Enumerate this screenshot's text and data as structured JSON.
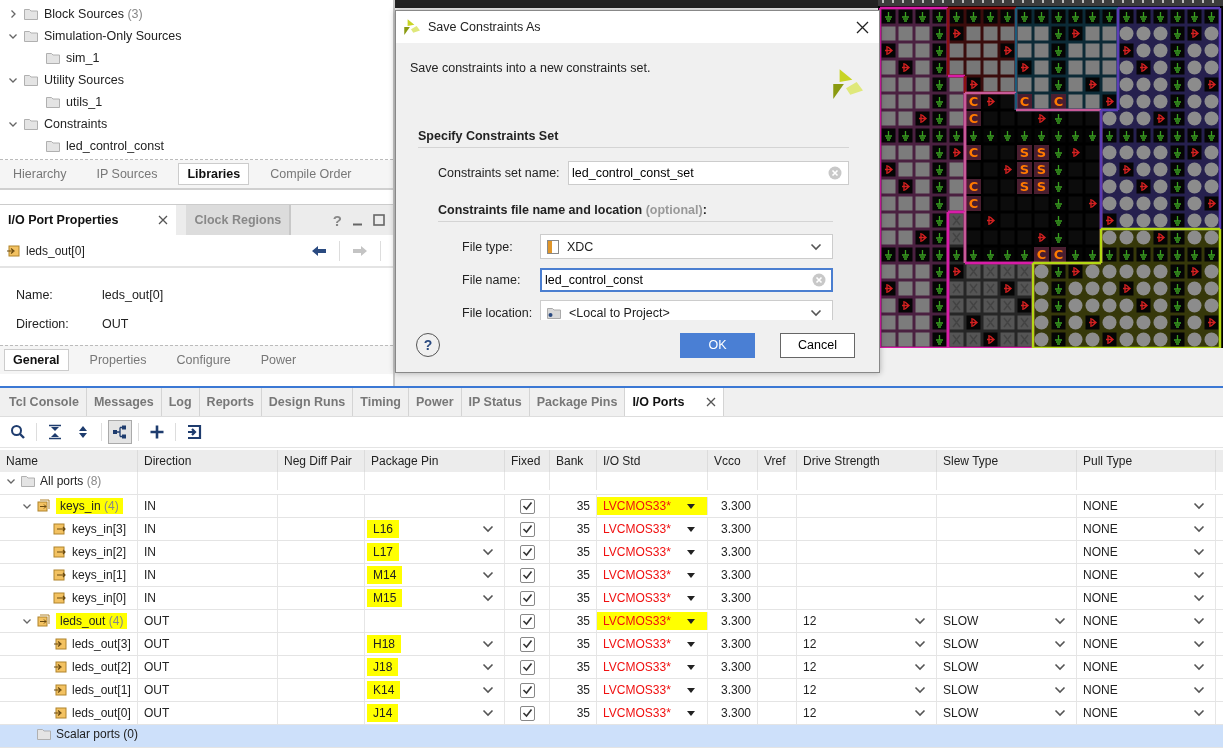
{
  "sources_tree": {
    "items": [
      {
        "label": "Block Sources",
        "count": "(3)",
        "expanded": false
      },
      {
        "label": "Simulation-Only Sources",
        "expanded": true,
        "children": [
          {
            "label": "sim_1"
          }
        ]
      },
      {
        "label": "Utility Sources",
        "expanded": true,
        "children": [
          {
            "label": "utils_1"
          }
        ]
      },
      {
        "label": "Constraints",
        "expanded": true,
        "children": [
          {
            "label": "led_control_const"
          }
        ]
      }
    ]
  },
  "sources_tabs": [
    {
      "label": "Hierarchy",
      "selected": false
    },
    {
      "label": "IP Sources",
      "selected": false
    },
    {
      "label": "Libraries",
      "selected": true
    },
    {
      "label": "Compile Order",
      "selected": false
    }
  ],
  "properties_panel": {
    "tabs": [
      {
        "label": "I/O Port Properties",
        "selected": true
      },
      {
        "label": "Clock Regions",
        "selected": false
      }
    ],
    "help": "?",
    "object": "leds_out[0]",
    "fields": [
      {
        "label": "Name:",
        "value": "leds_out[0]"
      },
      {
        "label": "Direction:",
        "value": "OUT"
      }
    ],
    "bottom_tabs": [
      {
        "label": "General",
        "selected": true
      },
      {
        "label": "Properties",
        "selected": false
      },
      {
        "label": "Configure",
        "selected": false
      },
      {
        "label": "Power",
        "selected": false
      }
    ]
  },
  "package_view": {
    "pin_labels": [
      "C",
      "C",
      "C",
      "C",
      "C",
      "C",
      "C",
      "C",
      "C",
      "S",
      "S",
      "S",
      "S",
      "S",
      "S"
    ]
  },
  "dialog": {
    "title": "Save Constraints As",
    "description": "Save constraints into a new constraints set.",
    "set_section": {
      "title": "Specify Constraints Set",
      "fields": [
        {
          "kind": "text",
          "label": "Constraints set name:",
          "value": "led_control_const_set",
          "focused": false
        }
      ]
    },
    "file_section": {
      "title": "Constraints file name and location",
      "note": "(optional)",
      "end": ":",
      "fields": [
        {
          "kind": "filetype",
          "label": "File type:",
          "value": "XDC"
        },
        {
          "kind": "text",
          "label": "File name:",
          "value": "led_control_const",
          "focused": true
        },
        {
          "kind": "location",
          "label": "File location:",
          "value": "<Local to Project>"
        }
      ]
    },
    "help": "?",
    "buttons": [
      {
        "label": "OK",
        "primary": true
      },
      {
        "label": "Cancel",
        "primary": false
      }
    ]
  },
  "bottom_tabs": [
    {
      "label": "Tcl Console",
      "selected": false
    },
    {
      "label": "Messages",
      "selected": false
    },
    {
      "label": "Log",
      "selected": false
    },
    {
      "label": "Reports",
      "selected": false
    },
    {
      "label": "Design Runs",
      "selected": false
    },
    {
      "label": "Timing",
      "selected": false
    },
    {
      "label": "Power",
      "selected": false
    },
    {
      "label": "IP Status",
      "selected": false
    },
    {
      "label": "Package Pins",
      "selected": false
    },
    {
      "label": "I/O Ports",
      "selected": true
    }
  ],
  "toolbar": [
    {
      "kind": "search",
      "pressed": false
    },
    {
      "kind": "collapse",
      "pressed": false
    },
    {
      "kind": "expand",
      "pressed": false
    },
    {
      "kind": "group",
      "pressed": true
    },
    {
      "kind": "add",
      "pressed": false
    },
    {
      "kind": "import",
      "pressed": false
    }
  ],
  "io_ports": {
    "columns": [
      "Name",
      "Direction",
      "Neg Diff Pair",
      "Package Pin",
      "Fixed",
      "Bank",
      "I/O Std",
      "Vcco",
      "Vref",
      "Drive Strength",
      "Slew Type",
      "Pull Type"
    ],
    "rows": [
      {
        "kind": "folder",
        "name": "All ports",
        "count": "(8)",
        "expanded": true,
        "selected": false,
        "children": [
          {
            "kind": "bus",
            "name": "keys_in",
            "count": "(4)",
            "highlighted": true,
            "expanded": true,
            "selected": false,
            "direction": "IN",
            "fixed": true,
            "bank": "35",
            "io_std": "LVCMOS33*",
            "io_std_highlighted": true,
            "vcco": "3.300",
            "pull_type": "NONE",
            "children": [
              {
                "kind": "input",
                "name": "keys_in[3]",
                "highlighted": false,
                "selected": false,
                "direction": "IN",
                "package_pin": "L16",
                "pin_highlighted": true,
                "fixed": true,
                "bank": "35",
                "io_std": "LVCMOS33*",
                "io_std_highlighted": false,
                "vcco": "3.300",
                "pull_type": "NONE"
              },
              {
                "kind": "input",
                "name": "keys_in[2]",
                "highlighted": false,
                "selected": false,
                "direction": "IN",
                "package_pin": "L17",
                "pin_highlighted": true,
                "fixed": true,
                "bank": "35",
                "io_std": "LVCMOS33*",
                "io_std_highlighted": false,
                "vcco": "3.300",
                "pull_type": "NONE"
              },
              {
                "kind": "input",
                "name": "keys_in[1]",
                "highlighted": false,
                "selected": false,
                "direction": "IN",
                "package_pin": "M14",
                "pin_highlighted": true,
                "fixed": true,
                "bank": "35",
                "io_std": "LVCMOS33*",
                "io_std_highlighted": false,
                "vcco": "3.300",
                "pull_type": "NONE"
              },
              {
                "kind": "input",
                "name": "keys_in[0]",
                "highlighted": false,
                "selected": false,
                "direction": "IN",
                "package_pin": "M15",
                "pin_highlighted": true,
                "fixed": true,
                "bank": "35",
                "io_std": "LVCMOS33*",
                "io_std_highlighted": false,
                "vcco": "3.300",
                "pull_type": "NONE"
              }
            ]
          },
          {
            "kind": "bus",
            "name": "leds_out",
            "count": "(4)",
            "highlighted": true,
            "expanded": true,
            "selected": false,
            "direction": "OUT",
            "fixed": true,
            "bank": "35",
            "io_std": "LVCMOS33*",
            "io_std_highlighted": true,
            "vcco": "3.300",
            "drive_strength": "12",
            "slew_type": "SLOW",
            "pull_type": "NONE",
            "children": [
              {
                "kind": "output",
                "name": "leds_out[3]",
                "highlighted": false,
                "selected": false,
                "direction": "OUT",
                "package_pin": "H18",
                "pin_highlighted": true,
                "fixed": true,
                "bank": "35",
                "io_std": "LVCMOS33*",
                "io_std_highlighted": false,
                "vcco": "3.300",
                "drive_strength": "12",
                "slew_type": "SLOW",
                "pull_type": "NONE"
              },
              {
                "kind": "output",
                "name": "leds_out[2]",
                "highlighted": false,
                "selected": false,
                "direction": "OUT",
                "package_pin": "J18",
                "pin_highlighted": true,
                "fixed": true,
                "bank": "35",
                "io_std": "LVCMOS33*",
                "io_std_highlighted": false,
                "vcco": "3.300",
                "drive_strength": "12",
                "slew_type": "SLOW",
                "pull_type": "NONE"
              },
              {
                "kind": "output",
                "name": "leds_out[1]",
                "highlighted": false,
                "selected": false,
                "direction": "OUT",
                "package_pin": "K14",
                "pin_highlighted": true,
                "fixed": true,
                "bank": "35",
                "io_std": "LVCMOS33*",
                "io_std_highlighted": false,
                "vcco": "3.300",
                "drive_strength": "12",
                "slew_type": "SLOW",
                "pull_type": "NONE"
              },
              {
                "kind": "output",
                "name": "leds_out[0]",
                "highlighted": false,
                "selected": false,
                "direction": "OUT",
                "package_pin": "J14",
                "pin_highlighted": true,
                "fixed": true,
                "bank": "35",
                "io_std": "LVCMOS33*",
                "io_std_highlighted": false,
                "vcco": "3.300",
                "drive_strength": "12",
                "slew_type": "SLOW",
                "pull_type": "NONE"
              }
            ]
          },
          {
            "kind": "folder",
            "name": "Scalar ports (0)",
            "selected": true
          }
        ]
      }
    ]
  }
}
